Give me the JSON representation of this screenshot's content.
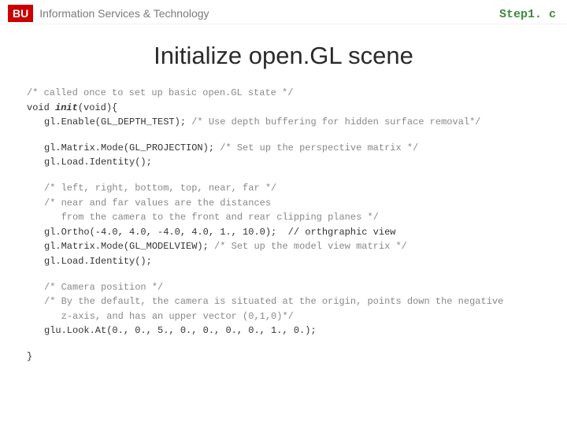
{
  "header": {
    "logo": "BU",
    "org": "Information Services & Technology",
    "filename": "Step1. c"
  },
  "title": "Initialize open.GL scene",
  "code": {
    "b1": {
      "c1": "/* called once to set up basic open.GL state */",
      "sig_kw": "void ",
      "sig_fn": "init",
      "sig_rest": "(void){",
      "l1a": "gl.Enable(GL_DEPTH_TEST); ",
      "l1b": "/* Use depth buffering for hidden surface removal*/"
    },
    "b2": {
      "l1a": "gl.Matrix.Mode(GL_PROJECTION); ",
      "l1b": "/* Set up the perspective matrix */",
      "l2": "gl.Load.Identity();"
    },
    "b3": {
      "c1": "/* left, right, bottom, top, near, far */",
      "c2": "/* near and far values are the distances",
      "c3": "   from the camera to the front and rear clipping planes */",
      "l1": "gl.Ortho(-4.0, 4.0, -4.0, 4.0, 1., 10.0);  // orthgraphic view",
      "l2a": "gl.Matrix.Mode(GL_MODELVIEW); ",
      "l2b": "/* Set up the model view matrix */",
      "l3": "gl.Load.Identity();"
    },
    "b4": {
      "c1": "/* Camera position */",
      "c2": "/* By the default, the camera is situated at the origin, points down the negative",
      "c3": "   z-axis, and has an upper vector (0,1,0)*/",
      "l1": "glu.Look.At(0., 0., 5., 0., 0., 0., 0., 1., 0.);"
    },
    "close": "}"
  }
}
